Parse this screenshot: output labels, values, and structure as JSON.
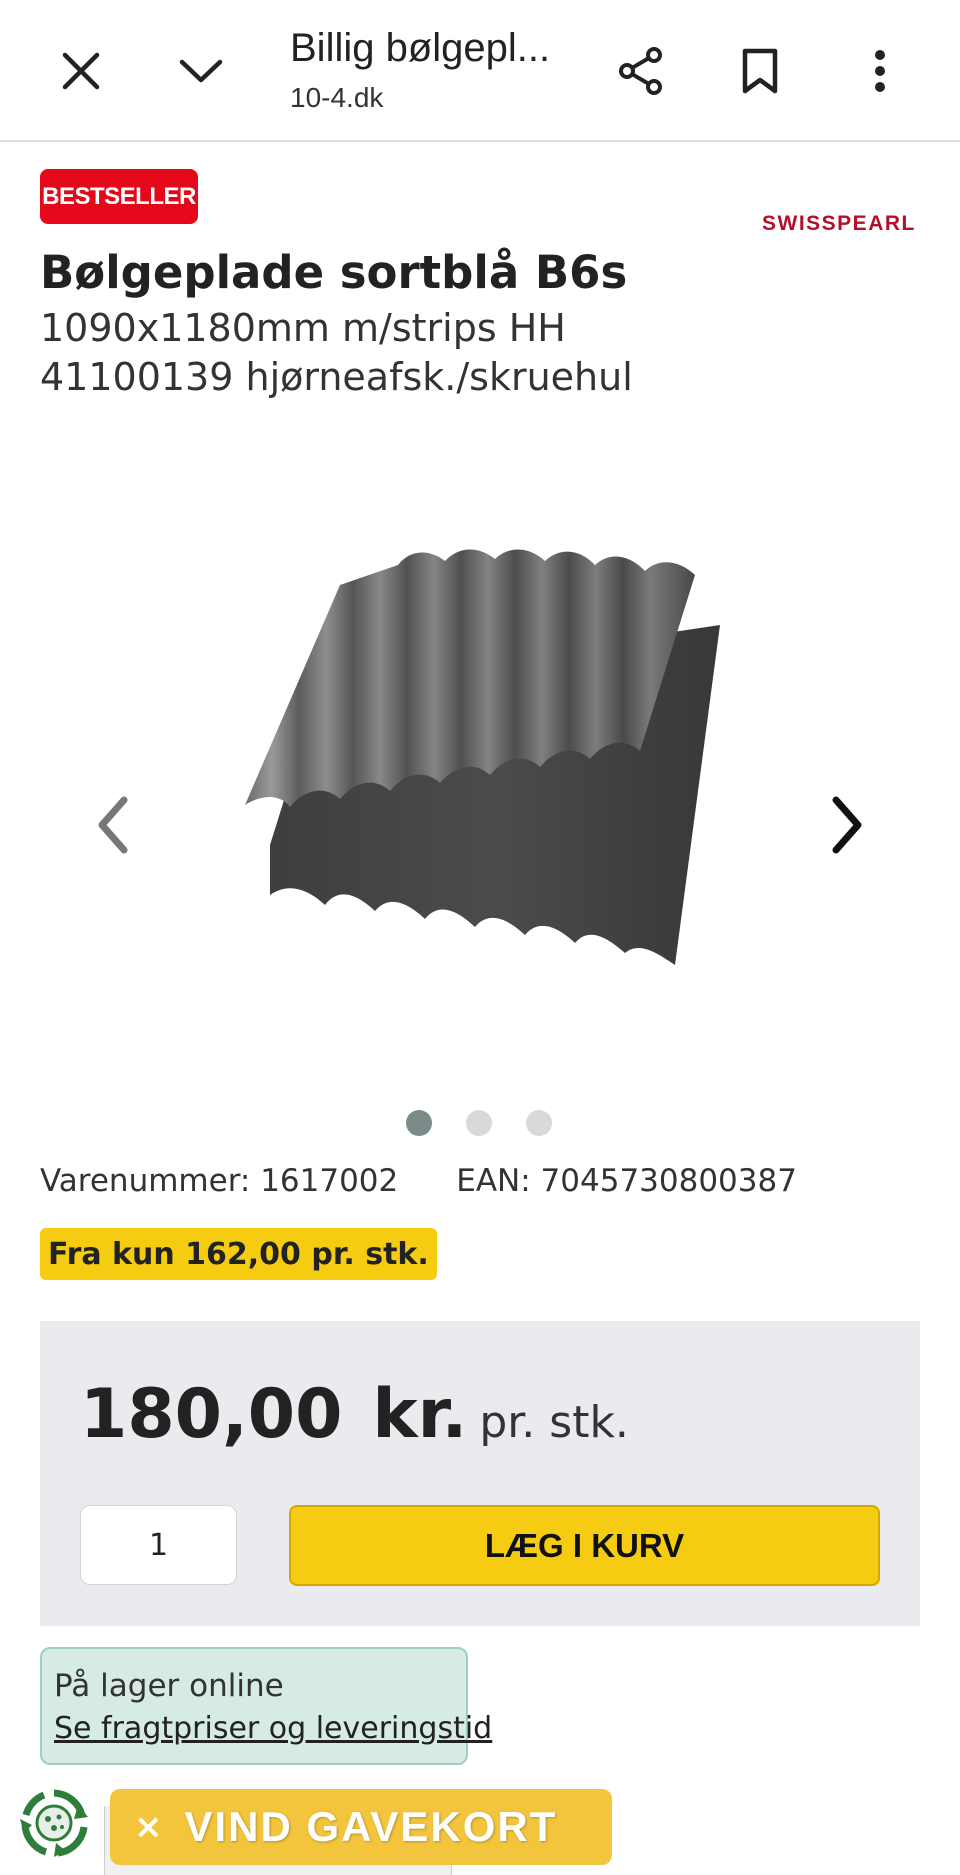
{
  "browser": {
    "page_title": "Billig bølgepl...",
    "url": "10-4.dk",
    "icons": [
      "close-icon",
      "chevron-down-icon",
      "share-icon",
      "bookmark-icon",
      "more-vert-icon"
    ]
  },
  "product": {
    "badge": "BESTSELLER",
    "brand": "SWISSPEARL",
    "title": "Bølgeplade sortblå B6s",
    "subtitle_line1": "1090x1180mm m/strips HH",
    "subtitle_line2": "41100139 hjørneafsk./skruehul",
    "image_count": 3,
    "active_image": 1,
    "varenummer": "Varenummer: 1617002",
    "ean": "EAN: 7045730800387",
    "from_price": "Fra kun 162,00 pr. stk."
  },
  "price": {
    "amount": "180,00",
    "currency": "kr.",
    "unit": "pr. stk.",
    "quantity": "1",
    "add_to_cart": "LÆG I KURV"
  },
  "stock": {
    "status": "På lager online",
    "shipping_link": "Se fragtpriser og leveringstid"
  },
  "promo": {
    "close": "×",
    "label": "VIND GAVEKORT"
  },
  "colors": {
    "badge": "#e4081a",
    "brand": "#b3112b",
    "accent_yellow": "#f6cc12",
    "promo_yellow": "#f2c53c",
    "stock_bg": "#d6ebe2"
  }
}
